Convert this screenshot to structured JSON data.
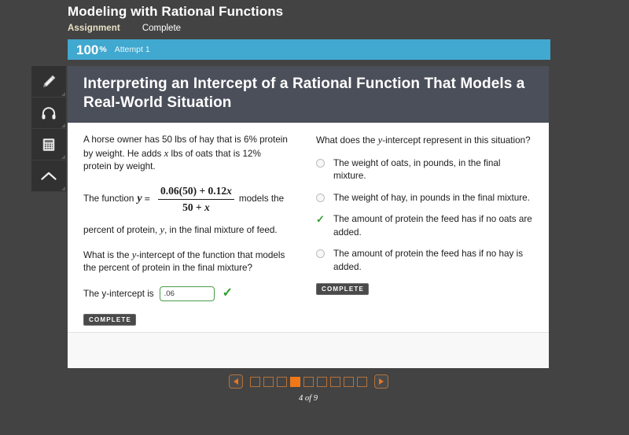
{
  "header": {
    "course_title": "Modeling with Rational Functions",
    "assignment_label": "Assignment",
    "status_label": "Complete"
  },
  "score_bar": {
    "value": "100",
    "percent_symbol": "%",
    "attempt": "Attempt 1",
    "color": "#41a8cf"
  },
  "tool_rail": {
    "items": [
      {
        "icon": "pencil-icon",
        "name": "highlighter-tool"
      },
      {
        "icon": "headphones-icon",
        "name": "audio-tool"
      },
      {
        "icon": "calculator-icon",
        "name": "calculator-tool"
      },
      {
        "icon": "chevron-up-icon",
        "name": "collapse-tool"
      }
    ]
  },
  "lesson": {
    "title": "Interpreting an Intercept of a Rational Function That Models a Real-World Situation",
    "title_band_color": "#4b4f5a",
    "left": {
      "paragraph1_a": "A horse owner has 50 lbs of hay that is 6% protein by weight. He adds ",
      "paragraph1_var": "x",
      "paragraph1_b": " lbs of oats that is 12% protein by weight.",
      "formula_prefix": "The function",
      "formula_lhs": "y",
      "formula_equals": "=",
      "formula_numerator": "0.06(50) + 0.12",
      "formula_numerator_var": "x",
      "formula_denominator": "50 + ",
      "formula_denominator_var": "x",
      "formula_suffix": "models the",
      "paragraph2_a": "percent of protein, ",
      "paragraph2_var": "y",
      "paragraph2_b": ", in the final mixture of feed.",
      "question_a": "What is the ",
      "question_var": "y",
      "question_b": "-intercept of the function that models the percent of protein in the final mixture?",
      "answer_label_a": "The ",
      "answer_label_var": "y",
      "answer_label_b": "-intercept is",
      "answer_value": ".06",
      "answer_placeholder": "",
      "answer_correct_mark": "✓",
      "complete_badge": "COMPLETE"
    },
    "right": {
      "question_a": "What does the ",
      "question_var": "y",
      "question_b": "-intercept represent in this situation?",
      "options": [
        {
          "label": "The weight of oats, in pounds, in the final mixture.",
          "selected": false
        },
        {
          "label": "The weight of hay, in pounds in the final mixture.",
          "selected": false
        },
        {
          "label": "The amount of protein the feed has if no oats are added.",
          "selected": true
        },
        {
          "label": "The amount of protein the feed has if no hay is added.",
          "selected": false
        }
      ],
      "correct_mark": "✓",
      "complete_badge": "COMPLETE"
    }
  },
  "pagination": {
    "prev_label": "◀",
    "next_label": "▶",
    "total_pages": 9,
    "current_page": 4,
    "label": "4 of 9",
    "accent_color": "#f07818"
  }
}
